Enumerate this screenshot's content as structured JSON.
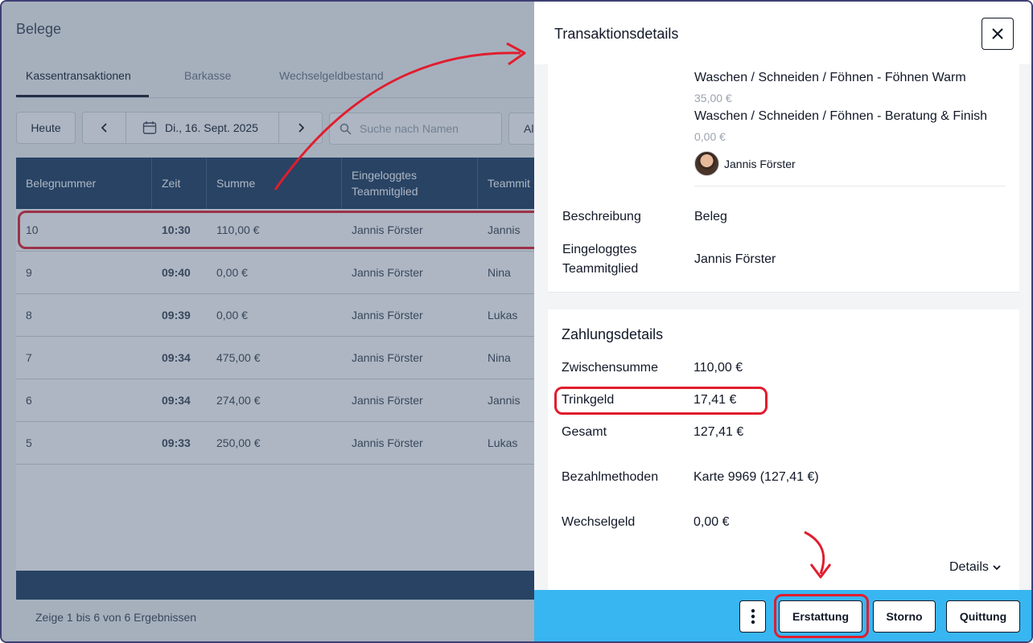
{
  "page": {
    "title": "Belege",
    "tabs": [
      {
        "label": "Kassentransaktionen",
        "active": true
      },
      {
        "label": "Barkasse",
        "active": false
      },
      {
        "label": "Wechselgeldbestand",
        "active": false
      }
    ]
  },
  "toolbar": {
    "today_label": "Heute",
    "date_label": "Di., 16. Sept. 2025",
    "search_placeholder": "Suche nach Namen",
    "filter_label": "Al"
  },
  "table": {
    "columns": [
      "Belegnummer",
      "Zeit",
      "Summe",
      "Eingeloggtes Teammitglied",
      "Teammit"
    ],
    "rows": [
      {
        "number": "10",
        "time": "10:30",
        "sum": "110,00 €",
        "logged_in": "Jannis Förster",
        "team": "Jannis"
      },
      {
        "number": "9",
        "time": "09:40",
        "sum": "0,00 €",
        "logged_in": "Jannis Förster",
        "team": "Nina"
      },
      {
        "number": "8",
        "time": "09:39",
        "sum": "0,00 €",
        "logged_in": "Jannis Förster",
        "team": "Lukas"
      },
      {
        "number": "7",
        "time": "09:34",
        "sum": "475,00 €",
        "logged_in": "Jannis Förster",
        "team": "Nina"
      },
      {
        "number": "6",
        "time": "09:34",
        "sum": "274,00 €",
        "logged_in": "Jannis Förster",
        "team": "Jannis"
      },
      {
        "number": "5",
        "time": "09:33",
        "sum": "250,00 €",
        "logged_in": "Jannis Förster",
        "team": "Lukas"
      }
    ],
    "results_text": "Zeige 1 bis 6 von 6 Ergebnissen"
  },
  "drawer": {
    "title": "Transaktionsdetails",
    "services": [
      {
        "name": "Waschen / Schneiden / Föhnen - Föhnen Warm",
        "price": "35,00 €"
      },
      {
        "name": "Waschen / Schneiden / Föhnen - Beratung & Finish",
        "price": "0,00 €"
      }
    ],
    "staff_name": "Jannis Förster",
    "description_label": "Beschreibung",
    "description_value": "Beleg",
    "logged_in_label_1": "Eingeloggtes",
    "logged_in_label_2": "Teammitglied",
    "logged_in_value": "Jannis Förster",
    "payment": {
      "title": "Zahlungsdetails",
      "subtotal_label": "Zwischensumme",
      "subtotal_value": "110,00 €",
      "tip_label": "Trinkgeld",
      "tip_value": "17,41 €",
      "total_label": "Gesamt",
      "total_value": "127,41 €",
      "methods_label": "Bezahlmethoden",
      "methods_value": "Karte 9969 (127,41 €)",
      "change_label": "Wechselgeld",
      "change_value": "0,00 €",
      "details_label": "Details"
    },
    "footer": {
      "refund_label": "Erstattung",
      "cancel_label": "Storno",
      "receipt_label": "Quittung"
    }
  },
  "colors": {
    "header_navy": "#1b3a5e",
    "footer_blue": "#38b6f2",
    "annotation_red": "#e11d2e"
  }
}
